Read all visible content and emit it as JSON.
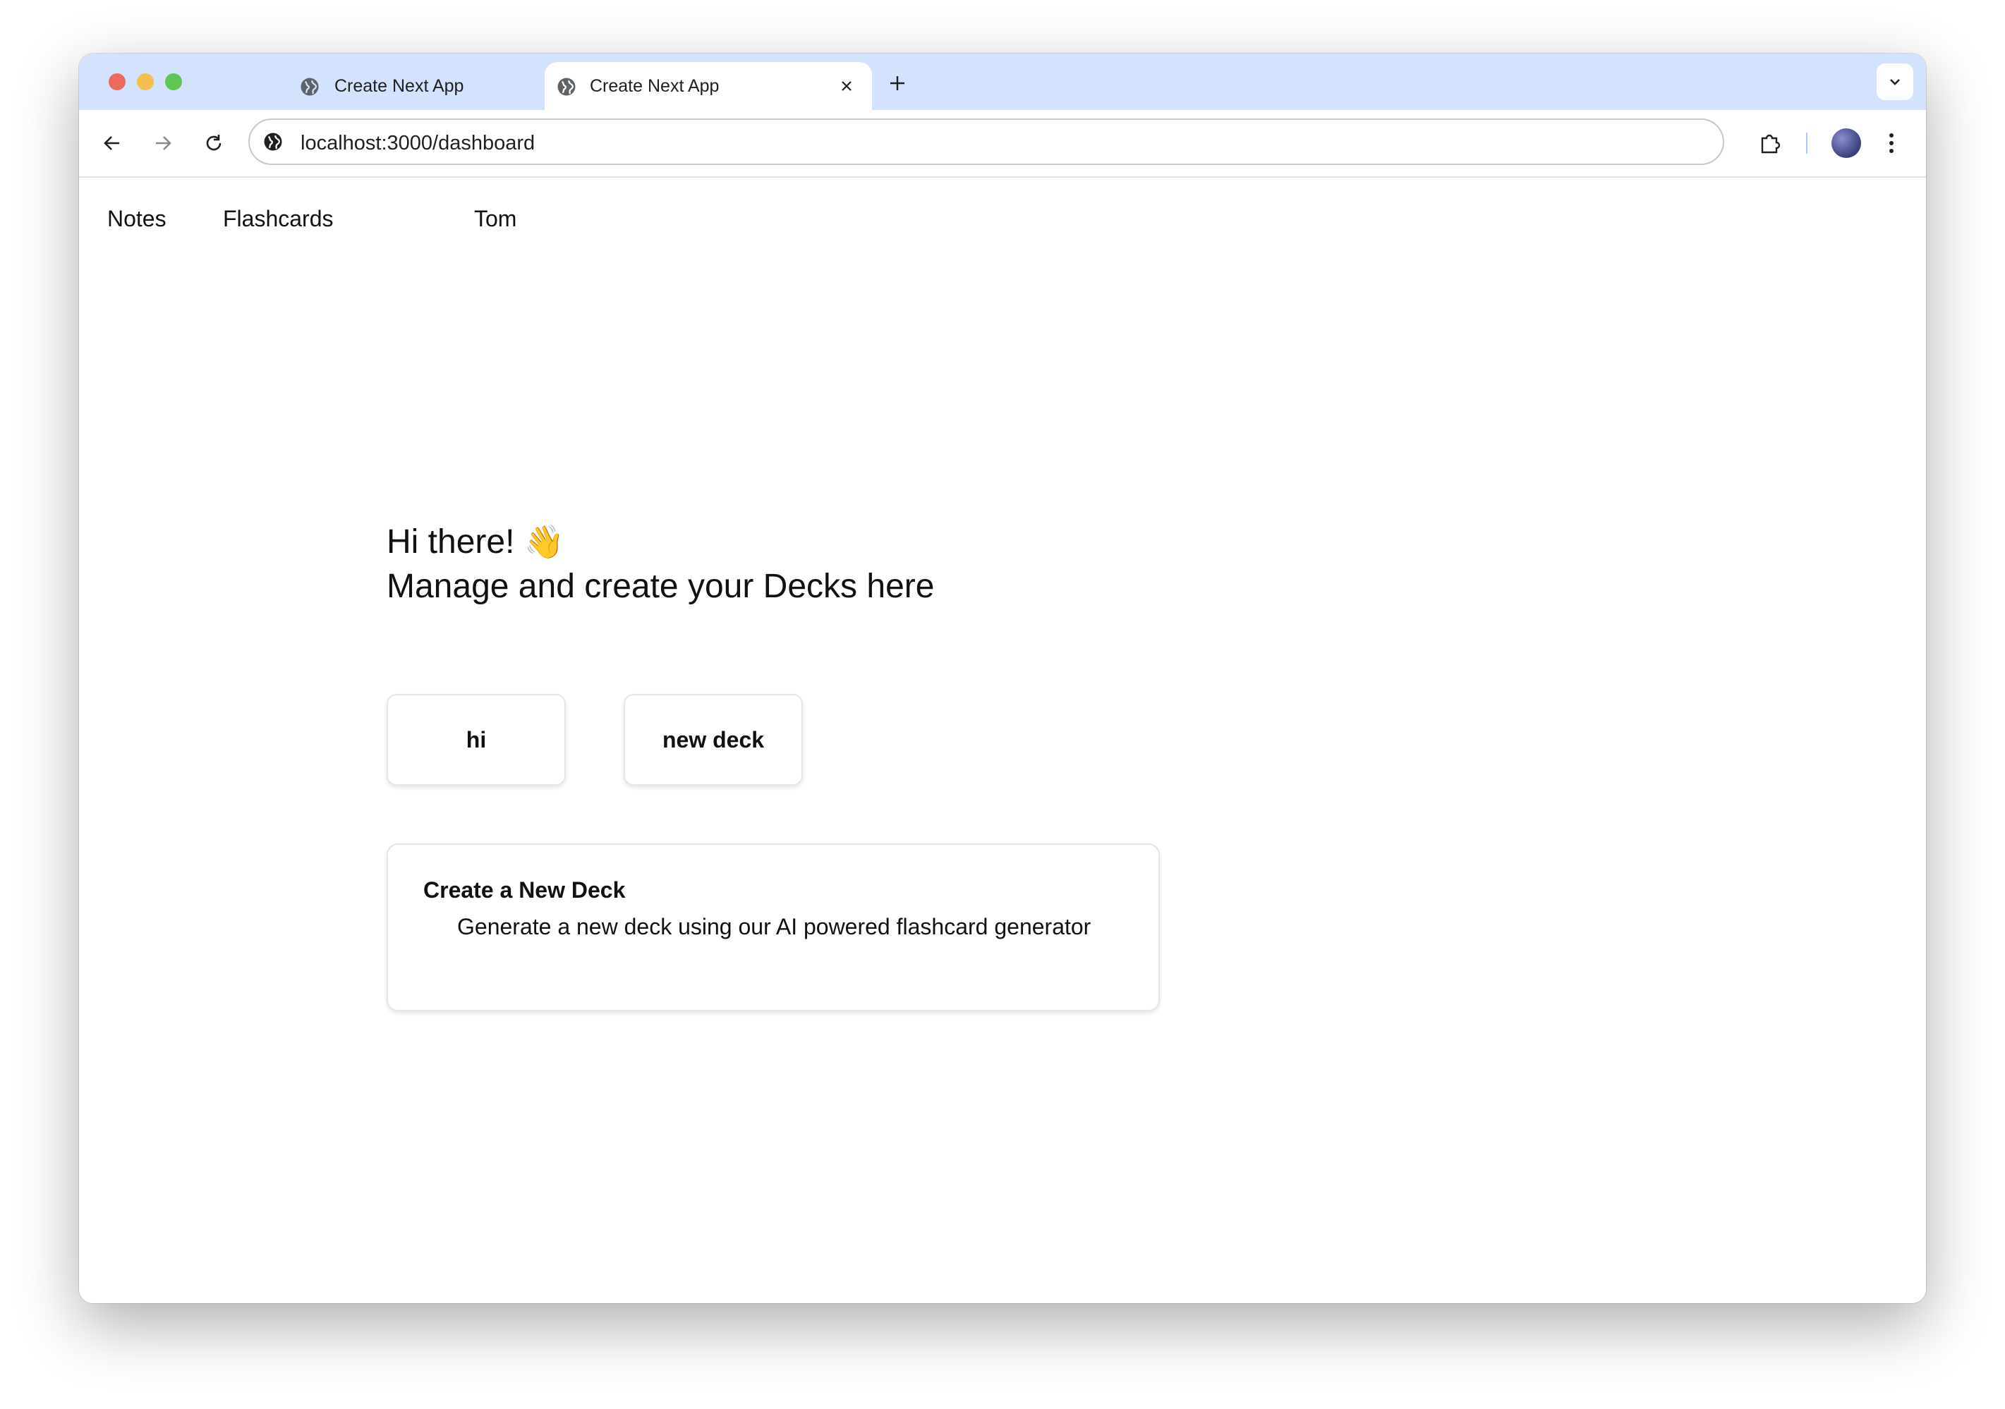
{
  "browser": {
    "tabs": [
      {
        "title": "Create Next App",
        "active": false
      },
      {
        "title": "Create Next App",
        "active": true
      }
    ],
    "url": "localhost:3000/dashboard",
    "accent": "#d3e3fd"
  },
  "nav": {
    "notes": "Notes",
    "flashcards": "Flashcards",
    "user": "Tom"
  },
  "main": {
    "greeting": "Hi there!",
    "wave_emoji": "👋",
    "subtitle": "Manage and create your Decks here",
    "decks": [
      "hi",
      "new deck"
    ],
    "create_card": {
      "title": "Create a New Deck",
      "description": "Generate a new deck using our AI powered flashcard generator"
    }
  },
  "icons": {
    "favicon": "globe-icon",
    "close": "close-icon",
    "new_tab": "plus-icon",
    "tab_search": "chevron-down-icon",
    "back": "arrow-left-icon",
    "forward": "arrow-right-icon",
    "reload": "reload-icon",
    "site_info": "globe-icon",
    "extensions": "puzzle-icon",
    "menu": "kebab-menu-icon"
  }
}
